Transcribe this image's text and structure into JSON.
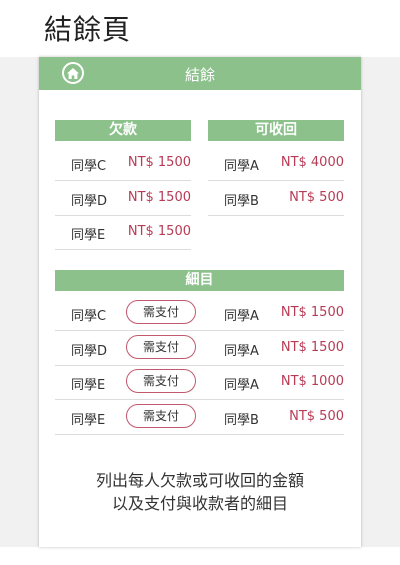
{
  "page_title": "結餘頁",
  "header": {
    "title": "結餘"
  },
  "debts": {
    "title": "欠款",
    "items": [
      {
        "name": "同學C",
        "amount": "NT$ 1500"
      },
      {
        "name": "同學D",
        "amount": "NT$ 1500"
      },
      {
        "name": "同學E",
        "amount": "NT$ 1500"
      }
    ]
  },
  "receivables": {
    "title": "可收回",
    "items": [
      {
        "name": "同學A",
        "amount": "NT$ 4000"
      },
      {
        "name": "同學B",
        "amount": "NT$ 500"
      }
    ]
  },
  "details": {
    "title": "細目",
    "pay_label": "需支付",
    "rows": [
      {
        "payer": "同學C",
        "payee": "同學A",
        "amount": "NT$ 1500"
      },
      {
        "payer": "同學D",
        "payee": "同學A",
        "amount": "NT$ 1500"
      },
      {
        "payer": "同學E",
        "payee": "同學A",
        "amount": "NT$ 1000"
      },
      {
        "payer": "同學E",
        "payee": "同學B",
        "amount": "NT$ 500"
      }
    ]
  },
  "note": {
    "line1": "列出每人欠款或可收回的金額",
    "line2": "以及支付與收款者的細目"
  }
}
